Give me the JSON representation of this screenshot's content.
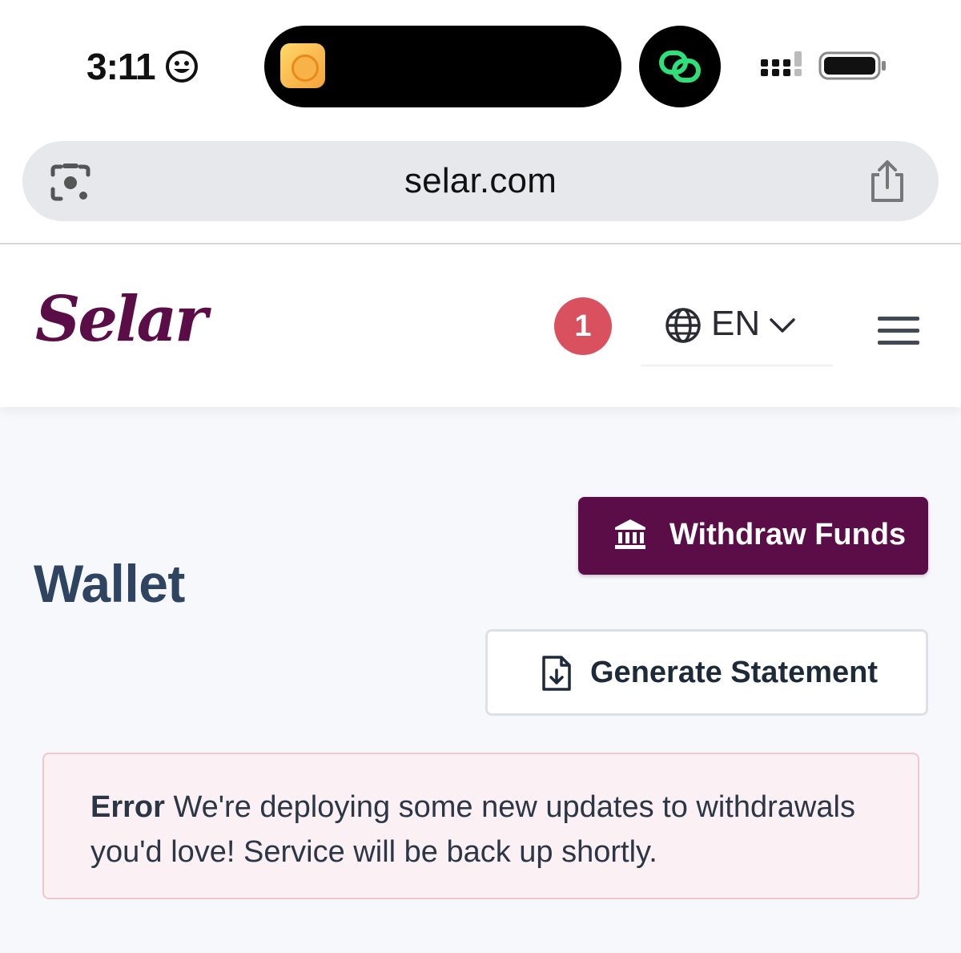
{
  "status_bar": {
    "time": "3:11",
    "icons": [
      "smiley-icon",
      "app-icon",
      "link-icon",
      "signal-icon",
      "battery-icon"
    ]
  },
  "browser": {
    "url": "selar.com",
    "icons": [
      "camera-lens-icon",
      "share-icon"
    ]
  },
  "header": {
    "logo": "Selar",
    "notification_count": "1",
    "language": "EN",
    "icons": [
      "globe-icon",
      "chevron-down-icon",
      "hamburger-menu-icon"
    ]
  },
  "wallet": {
    "title": "Wallet",
    "withdraw_label": "Withdraw Funds",
    "statement_label": "Generate Statement",
    "icons": [
      "bank-icon",
      "file-download-icon"
    ]
  },
  "alert": {
    "label": "Error",
    "message": "We're deploying some new updates to withdrawals you'd love! Service will be back up shortly."
  },
  "colors": {
    "brand": "#5a0d47",
    "badge": "#d9515f",
    "title": "#2e4461",
    "alert_bg": "#fbf0f3",
    "alert_border": "#f1c6cd"
  }
}
